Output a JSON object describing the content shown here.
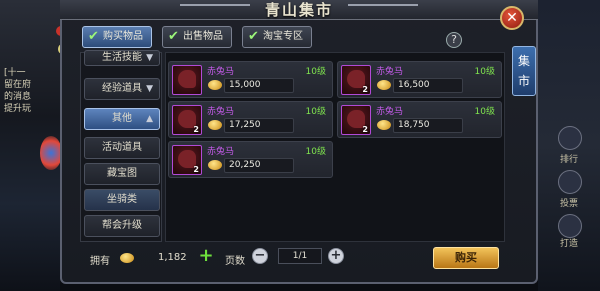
{
  "window": {
    "title": "青山集市"
  },
  "tabs": [
    {
      "label": "购买物品",
      "active": true
    },
    {
      "label": "出售物品",
      "active": false
    },
    {
      "label": "淘宝专区",
      "active": false
    }
  ],
  "side_tab": {
    "label": "集市"
  },
  "categories": [
    {
      "label": "生活技能",
      "arrow": "chevron-down"
    },
    {
      "label": "经验道具",
      "arrow": "chevron-down"
    },
    {
      "label": "其他",
      "arrow": "chevron-up",
      "selected": true
    },
    {
      "label": "活动道具"
    },
    {
      "label": "藏宝图"
    },
    {
      "label": "坐骑类"
    },
    {
      "label": "帮会升级"
    }
  ],
  "items": [
    {
      "name": "赤兔马",
      "level": "10级",
      "price": "15,000",
      "qty": ""
    },
    {
      "name": "赤兔马",
      "level": "10级",
      "price": "16,500",
      "qty": "2"
    },
    {
      "name": "赤兔马",
      "level": "10级",
      "price": "17,250",
      "qty": "2"
    },
    {
      "name": "赤兔马",
      "level": "10级",
      "price": "18,750",
      "qty": "2"
    },
    {
      "name": "赤兔马",
      "level": "10级",
      "price": "20,250",
      "qty": "2"
    }
  ],
  "footer": {
    "owned_label": "拥有",
    "owned_amount": "1,182",
    "page_label": "页数",
    "page_value": "1/1",
    "buy_label": "购买"
  },
  "background": {
    "left_text": [
      "[十一",
      "留在府",
      "的消息",
      "提升玩"
    ],
    "right_labels": [
      "排行",
      "投票",
      "打造"
    ]
  },
  "colors": {
    "accent_blue": "#2d4c7a",
    "item_name_purple": "#c35be8",
    "level_green": "#7fe34e",
    "buy_gold": "#f2c35a"
  }
}
